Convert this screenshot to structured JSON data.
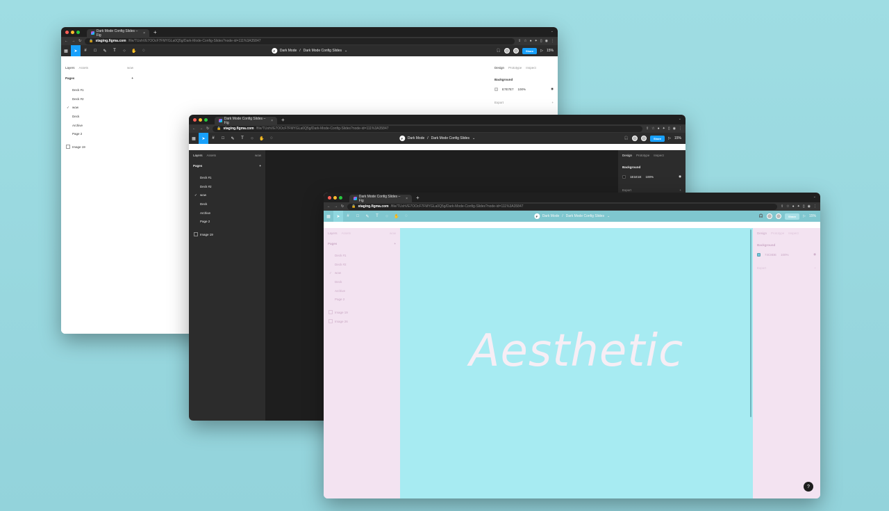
{
  "browser": {
    "tab_title": "Dark Mode Config Slides – Fig",
    "tab_close": "×",
    "new_tab": "+",
    "url_host": "staging.figma.com",
    "url_path": "/file/TUshVE7OOcF7FMYGLa0Q5g/Dark-Mode-Config-Slides?node-id=111%3A35847"
  },
  "figma": {
    "file_owner_initial": "F",
    "project": "Dark Mode",
    "file_name": "Dark Mode Config Slides",
    "share_label": "Share",
    "zoom": "15%"
  },
  "left_panel": {
    "tab_layers": "Layers",
    "tab_assets": "Assets",
    "current_page_short": "wow",
    "pages_heading": "Pages",
    "add": "+",
    "pages": [
      "Deck #1",
      "Deck #2",
      "wow",
      "Deck",
      "Archive",
      "Page 2"
    ],
    "current_page_index": 2,
    "layers": {
      "light": [
        "Image 19"
      ],
      "dark": [
        "Image 19"
      ],
      "aesthetic": [
        "Image 19",
        "Image 26"
      ]
    }
  },
  "right_panel": {
    "tab_design": "Design",
    "tab_prototype": "Prototype",
    "tab_inspect": "Inspect",
    "background_heading": "Background",
    "export_label": "Export",
    "opacity": "100%",
    "bg_hex": {
      "light": "E7E7E7",
      "dark": "1E1E1E",
      "aesthetic": "74C8DE"
    }
  },
  "canvas": {
    "aesthetic_text": "Aesthetic"
  },
  "colors": {
    "light_bg": "#ffffff",
    "dark_bg": "#1e1e1e",
    "aesthetic_canvas": "#a7ebf2",
    "aesthetic_panel": "#f3e3f1",
    "accent": "#18a0fb"
  },
  "help": "?"
}
